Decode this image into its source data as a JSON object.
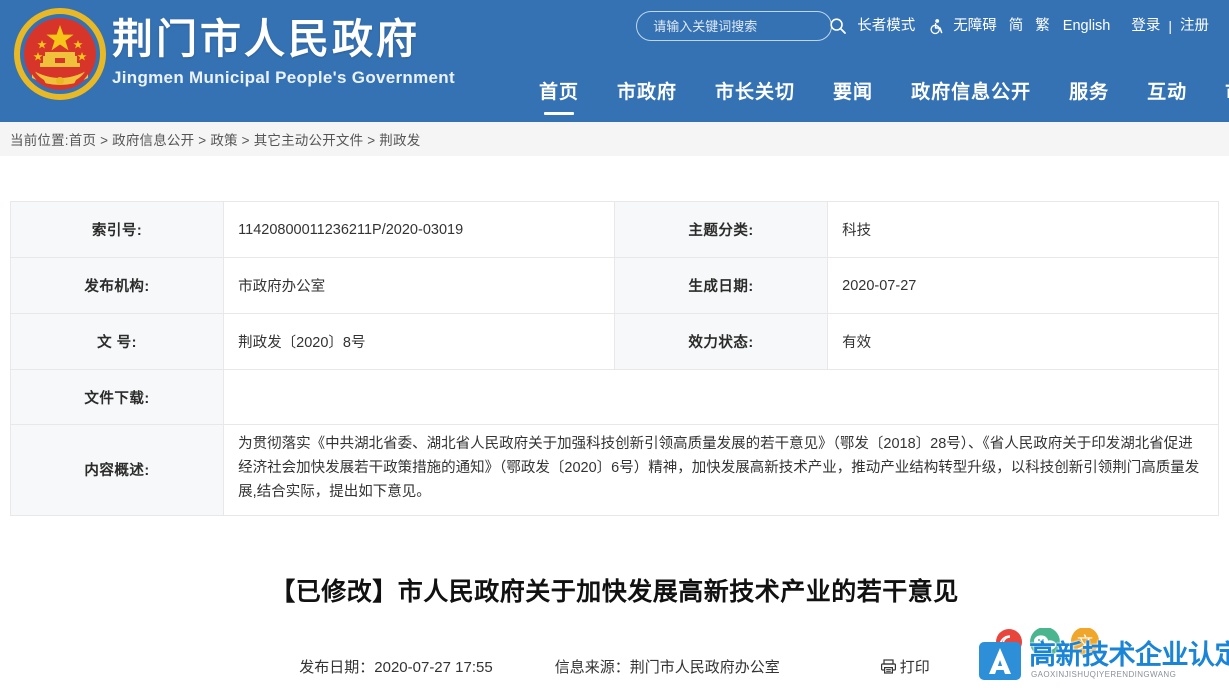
{
  "site": {
    "emblem_icon": "china-national-emblem",
    "title_cn": "荆门市人民政府",
    "title_en": "Jingmen Municipal People's Government",
    "header_bg_color": "#3572b3"
  },
  "search": {
    "placeholder": "请输入关键词搜索",
    "value": "",
    "icon": "search-icon"
  },
  "utility": {
    "elder_mode": "长者模式",
    "accessibility_icon": "wheelchair-accessibility-icon",
    "accessibility": "无障碍",
    "simplified": "简",
    "traditional": "繁",
    "english": "English",
    "login": "登录",
    "separator": "|",
    "register": "注册"
  },
  "nav": {
    "items": [
      {
        "label": "首页",
        "active": true
      },
      {
        "label": "市政府",
        "active": false
      },
      {
        "label": "市长关切",
        "active": false
      },
      {
        "label": "要闻",
        "active": false
      },
      {
        "label": "政府信息公开",
        "active": false
      },
      {
        "label": "服务",
        "active": false
      },
      {
        "label": "互动",
        "active": false
      },
      {
        "label": "市情",
        "active": false
      }
    ]
  },
  "breadcrumb": {
    "text": "当前位置:首页 > 政府信息公开 > 政策 > 其它主动公开文件 > 荆政发"
  },
  "info_table": {
    "rows": [
      {
        "label_left": "索引号:",
        "value_left": "11420800011236211P/2020-03019",
        "label_right": "主题分类:",
        "value_right": "科技"
      },
      {
        "label_left": "发布机构:",
        "value_left": "市政府办公室",
        "label_right": "生成日期:",
        "value_right": "2020-07-27"
      },
      {
        "label_left": "文 号:",
        "value_left": "荆政发〔2020〕8号",
        "label_right": "效力状态:",
        "value_right": "有效"
      }
    ],
    "download_label": "文件下载:",
    "download_value": "",
    "summary_label": "内容概述:",
    "summary_value": "为贯彻落实《中共湖北省委、湖北省人民政府关于加强科技创新引领高质量发展的若干意见》（鄂发〔2018〕28号）、《省人民政府关于印发湖北省促进经济社会加快发展若干政策措施的通知》（鄂政发〔2020〕6号）精神，加快发展高新技术产业，推动产业结构转型升级，以科技创新引领荆门高质量发展,结合实际，提出如下意见。"
  },
  "article": {
    "title": "【已修改】市人民政府关于加快发展高新技术产业的若干意见",
    "publish_date": "发布日期：2020-07-27 17:55",
    "source": "信息来源：荆门市人民政府办公室",
    "print_label": "打印",
    "print_icon": "printer-icon"
  },
  "watermark": {
    "logo_icon": "a-letter-logo-icon",
    "text": "高新技术企业认定网",
    "pinyin": "GAOXINJISHUQIYERENDINGWANG",
    "color": "#1a84d6"
  }
}
